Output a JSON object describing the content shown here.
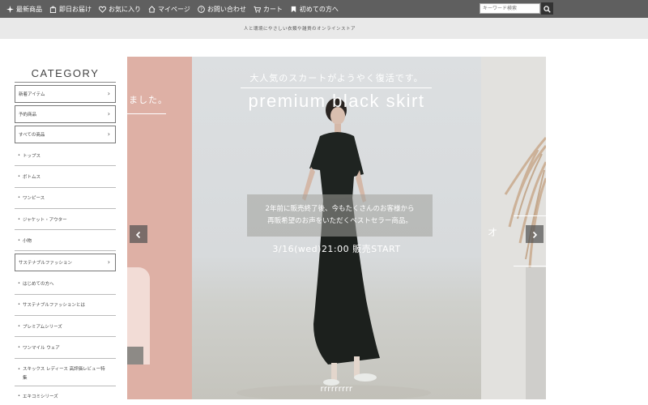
{
  "nav": {
    "items": [
      {
        "label": "最新商品",
        "icon": "sparkle-icon"
      },
      {
        "label": "即日お届け",
        "icon": "bag-icon"
      },
      {
        "label": "お気に入り",
        "icon": "heart-icon"
      },
      {
        "label": "マイページ",
        "icon": "home-icon"
      },
      {
        "label": "お問い合わせ",
        "icon": "help-icon"
      },
      {
        "label": "カート",
        "icon": "cart-icon"
      },
      {
        "label": "初めての方へ",
        "icon": "leaf-icon"
      }
    ],
    "search_placeholder": "キーワード検索"
  },
  "tagline": "人と環境にやさしい衣類や雑貨のオンラインストア",
  "sidebar": {
    "title": "CATEGORY",
    "items": [
      {
        "label": "新着アイテム",
        "boxed": true
      },
      {
        "label": "予約商品",
        "boxed": true
      },
      {
        "label": "すべての商品",
        "boxed": true
      },
      {
        "label": "トップス",
        "boxed": false
      },
      {
        "label": "ボトムス",
        "boxed": false
      },
      {
        "label": "ワンピース",
        "boxed": false
      },
      {
        "label": "ジャケット・アウター",
        "boxed": false
      },
      {
        "label": "小物",
        "boxed": false
      },
      {
        "label": "サステナブルファッション",
        "boxed": true
      },
      {
        "label": "はじめての方へ",
        "boxed": false
      },
      {
        "label": "サステナブルファッションとは",
        "boxed": false
      },
      {
        "label": "プレミアムシリーズ",
        "boxed": false
      },
      {
        "label": "ワンマイル ウェア",
        "boxed": false
      },
      {
        "label": "スキックス レディース 高評価レビュー特集",
        "boxed": false
      },
      {
        "label": "エキコミシリーズ",
        "boxed": false
      }
    ]
  },
  "slider": {
    "left_text": "ました。",
    "heading": "大人気のスカートがようやく復活です。",
    "title": "premium black skirt",
    "message_line1": "2年前に販売終了後、今もたくさんのお客様から",
    "message_line2": "再販希望のお声をいただくベストセラー商品。",
    "date": "3/16(wed)21:00 販売START",
    "dots": "rrrrrrrrr",
    "right_text": "オ"
  },
  "colors": {
    "topbar": "#5f5f5f",
    "subbar": "#e9e9e9",
    "slide_left": "#deb0a5"
  }
}
